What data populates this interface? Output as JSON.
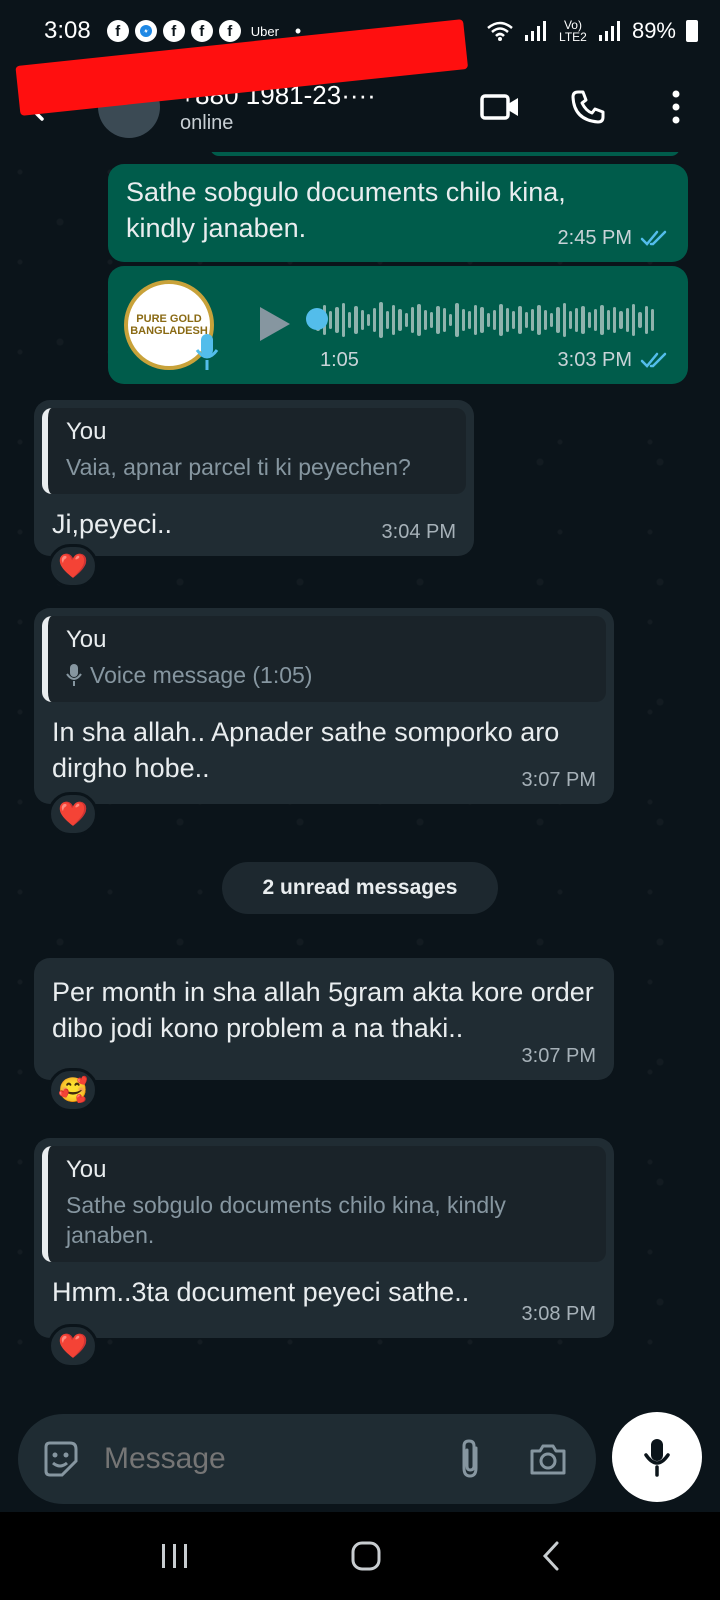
{
  "status_bar": {
    "time": "3:08",
    "app_badge": "Uber",
    "network": "Vo) LTE2",
    "battery": "89%"
  },
  "header": {
    "contact_name": "+880 1981-23····",
    "status": "online"
  },
  "messages": [
    {
      "type": "out",
      "text": "Sathe sobgulo documents chilo kina, kindly janaben.",
      "time": "2:45 PM"
    },
    {
      "type": "voice_out",
      "logo": "PURE GOLD BANGLADESH",
      "duration": "1:05",
      "time": "3:03 PM"
    },
    {
      "type": "in",
      "quote_author": "You",
      "quote_text": "Vaia, apnar parcel ti ki peyechen?",
      "text": "Ji,peyeci..",
      "time": "3:04 PM",
      "reaction": "❤️"
    },
    {
      "type": "in",
      "quote_author": "You",
      "quote_text": "Voice message (1:05)",
      "text": "In sha allah.. Apnader sathe somporko aro dirgho hobe..",
      "time": "3:07 PM",
      "reaction": "❤️"
    },
    {
      "type": "in",
      "text": "Per month in sha allah 5gram akta kore order dibo jodi kono problem a na thaki..",
      "time": "3:07 PM",
      "reaction": "🥰"
    },
    {
      "type": "in",
      "quote_author": "You",
      "quote_text": "Sathe sobgulo documents chilo kina, kindly janaben.",
      "text": "Hmm..3ta document peyeci sathe..",
      "time": "3:08 PM",
      "reaction": "❤️"
    }
  ],
  "unread_label": "2 unread messages",
  "composer": {
    "placeholder": "Message"
  },
  "colors": {
    "background": "#0b141a",
    "outgoing_bubble": "#005c4b",
    "incoming_bubble": "#202c33",
    "read_ticks": "#53bdeb"
  }
}
